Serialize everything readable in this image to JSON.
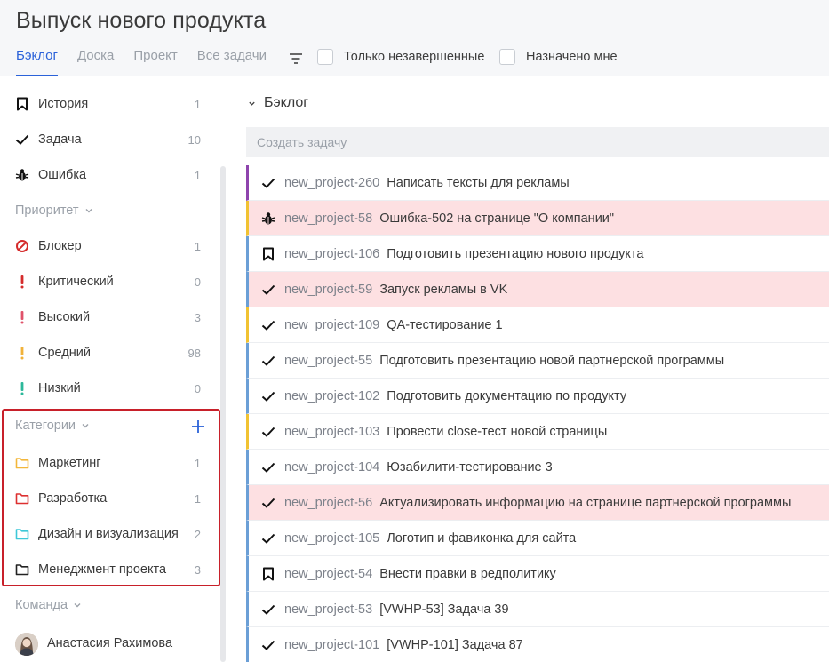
{
  "header": {
    "title": "Выпуск нового продукта",
    "tabs": [
      {
        "label": "Бэклог",
        "active": true
      },
      {
        "label": "Доска",
        "active": false
      },
      {
        "label": "Проект",
        "active": false
      },
      {
        "label": "Все задачи",
        "active": false
      }
    ],
    "filter_icon": "filter-icon",
    "only_unfinished_label": "Только незавершенные",
    "assigned_to_me_label": "Назначено мне"
  },
  "sidebar": {
    "types": [
      {
        "label": "История",
        "count": "1",
        "icon": "bookmark-icon"
      },
      {
        "label": "Задача",
        "count": "10",
        "icon": "check-icon"
      },
      {
        "label": "Ошибка",
        "count": "1",
        "icon": "bug-icon"
      }
    ],
    "priority_heading": "Приоритет",
    "priorities": [
      {
        "label": "Блокер",
        "count": "1",
        "icon": "blocker-icon",
        "color": "#d52b2b"
      },
      {
        "label": "Критический",
        "count": "0",
        "icon": "exclamation-icon",
        "color": "#d52b2b"
      },
      {
        "label": "Высокий",
        "count": "3",
        "icon": "exclamation-icon",
        "color": "#e0526a"
      },
      {
        "label": "Средний",
        "count": "98",
        "icon": "exclamation-icon",
        "color": "#f1b23a"
      },
      {
        "label": "Низкий",
        "count": "0",
        "icon": "exclamation-icon",
        "color": "#2cb89a"
      }
    ],
    "categories_heading": "Категории",
    "categories": [
      {
        "label": "Маркетинг",
        "count": "1",
        "icon": "folder-icon",
        "color": "#f3b73b"
      },
      {
        "label": "Разработка",
        "count": "1",
        "icon": "folder-icon",
        "color": "#dd3030"
      },
      {
        "label": "Дизайн и визуализация",
        "count": "2",
        "icon": "folder-icon",
        "color": "#3ec8d8"
      },
      {
        "label": "Менеджмент проекта",
        "count": "3",
        "icon": "folder-icon",
        "color": "#222222"
      }
    ],
    "team_heading": "Команда",
    "user": {
      "name": "Анастасия Рахимова"
    },
    "categories_highlight_color": "#c8202a",
    "accent_color": "#2b62d9"
  },
  "main": {
    "section_title": "Бэклог",
    "create_placeholder": "Создать задачу",
    "tasks": [
      {
        "key": "new_project-260",
        "title": "Написать тексты для рекламы",
        "icon": "check-icon",
        "bar": "#8e44ad",
        "highlight": false
      },
      {
        "key": "new_project-58",
        "title": "Ошибка-502 на странице \"О компании\"",
        "icon": "bug-icon",
        "bar": "#f1c232",
        "highlight": true
      },
      {
        "key": "new_project-106",
        "title": "Подготовить презентацию нового продукта",
        "icon": "bookmark-icon",
        "bar": "#6b9fd6",
        "highlight": false
      },
      {
        "key": "new_project-59",
        "title": "Запуск рекламы в VK",
        "icon": "check-icon",
        "bar": "#6b9fd6",
        "highlight": true
      },
      {
        "key": "new_project-109",
        "title": "QA-тестирование 1",
        "icon": "check-icon",
        "bar": "#f1c232",
        "highlight": false
      },
      {
        "key": "new_project-55",
        "title": "Подготовить презентацию новой партнерской программы",
        "icon": "check-icon",
        "bar": "#6b9fd6",
        "highlight": false
      },
      {
        "key": "new_project-102",
        "title": "Подготовить документацию по продукту",
        "icon": "check-icon",
        "bar": "#6b9fd6",
        "highlight": false
      },
      {
        "key": "new_project-103",
        "title": "Провести close-тест новой страницы",
        "icon": "check-icon",
        "bar": "#f1c232",
        "highlight": false
      },
      {
        "key": "new_project-104",
        "title": "Юзабилити-тестирование 3",
        "icon": "check-icon",
        "bar": "#6b9fd6",
        "highlight": false
      },
      {
        "key": "new_project-56",
        "title": "Актуализировать информацию на странице партнерской программы",
        "icon": "check-icon",
        "bar": "#6b9fd6",
        "highlight": true
      },
      {
        "key": "new_project-105",
        "title": "Логотип и фавиконка для сайта",
        "icon": "check-icon",
        "bar": "#6b9fd6",
        "highlight": false
      },
      {
        "key": "new_project-54",
        "title": "Внести правки в редполитику",
        "icon": "bookmark-icon",
        "bar": "#6b9fd6",
        "highlight": false
      },
      {
        "key": "new_project-53",
        "title": "[VWHP-53] Задача 39",
        "icon": "check-icon",
        "bar": "#6b9fd6",
        "highlight": false
      },
      {
        "key": "new_project-101",
        "title": "[VWHP-101] Задача 87",
        "icon": "check-icon",
        "bar": "#6b9fd6",
        "highlight": false
      }
    ]
  }
}
